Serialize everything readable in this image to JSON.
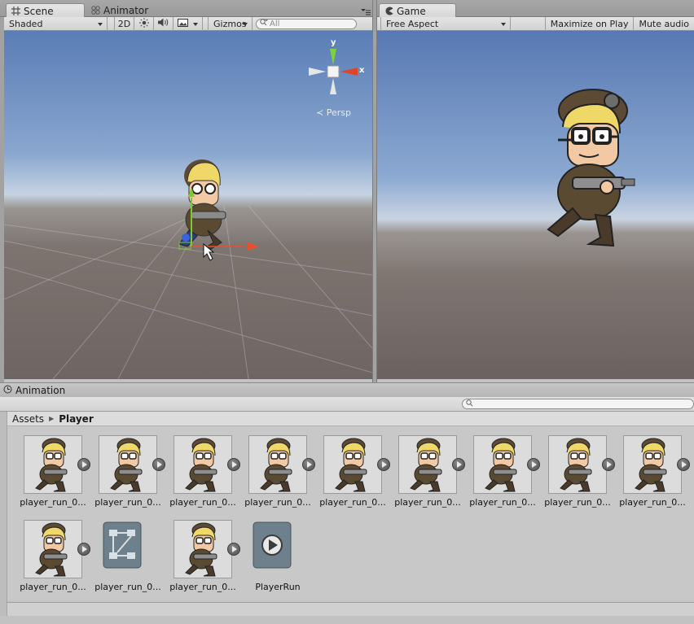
{
  "scene": {
    "tab_label": "Scene",
    "animator_tab_label": "Animator",
    "toolbar": {
      "shading_mode": "Shaded",
      "mode_2d": "2D",
      "gizmos_label": "Gizmos",
      "search_placeholder": "All"
    },
    "gizmo": {
      "y_label": "y",
      "x_label": "x",
      "projection_label": "Persp"
    }
  },
  "game": {
    "tab_label": "Game",
    "aspect": "Free Aspect",
    "maximize_label": "Maximize on Play",
    "mute_label": "Mute audio"
  },
  "animation": {
    "panel_label": "Animation",
    "breadcrumb": {
      "root": "Assets",
      "current": "Player"
    },
    "assets": [
      {
        "label": "player_run_0...",
        "kind": "sprite"
      },
      {
        "label": "player_run_0...",
        "kind": "sprite"
      },
      {
        "label": "player_run_0...",
        "kind": "sprite"
      },
      {
        "label": "player_run_0...",
        "kind": "sprite"
      },
      {
        "label": "player_run_0...",
        "kind": "sprite"
      },
      {
        "label": "player_run_0...",
        "kind": "sprite"
      },
      {
        "label": "player_run_0...",
        "kind": "sprite"
      },
      {
        "label": "player_run_0...",
        "kind": "sprite"
      },
      {
        "label": "player_run_0...",
        "kind": "sprite"
      },
      {
        "label": "player_run_0...",
        "kind": "sprite"
      },
      {
        "label": "player_run_0...",
        "kind": "controller"
      },
      {
        "label": "player_run_0...",
        "kind": "sprite"
      },
      {
        "label": "PlayerRun",
        "kind": "clip"
      }
    ]
  },
  "colors": {
    "axis_x": "#e8502c",
    "axis_y": "#7ec832",
    "axis_z": "#3a64d8",
    "character_jacket": "#5a4a32",
    "character_hair": "#f0d868"
  }
}
